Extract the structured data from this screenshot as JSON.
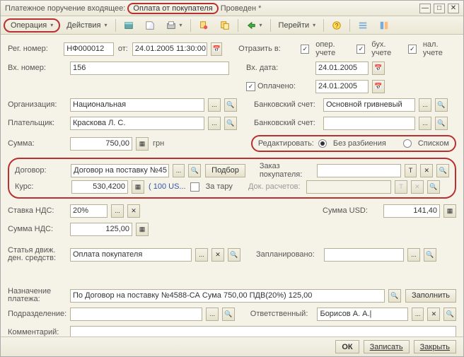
{
  "title": {
    "pre": "Платежное поручение входящее:",
    "hl": "Оплата от покупателя",
    "post": "Проведен *"
  },
  "toolbar": {
    "operation": "Операция",
    "actions": "Действия",
    "goto": "Перейти"
  },
  "labels": {
    "reg_no": "Рег. номер:",
    "from": "от:",
    "in_no": "Вх. номер:",
    "org": "Организация:",
    "payer": "Плательщик:",
    "sum": "Сумма:",
    "currency": "грн",
    "contract": "Договор:",
    "select": "Подбор",
    "rate": "Курс:",
    "rate_hint": "( 100 US...",
    "tare": "За тару",
    "vat_rate": "Ставка НДС:",
    "vat_sum": "Сумма НДС:",
    "cash_flow": "Статья движ. ден. средств:",
    "purpose": "Назначение платежа:",
    "fill": "Заполнить",
    "dept": "Подразделение:",
    "comment": "Комментарий:",
    "reflect": "Отразить в:",
    "oper": "опер. учете",
    "buh": "бух. учете",
    "nal": "нал. учете",
    "in_date": "Вх. дата:",
    "paid": "Оплачено:",
    "bank_acc": "Банковский счет:",
    "bank_acc2": "Банковский счет:",
    "edit": "Редактировать:",
    "no_split": "Без разбиения",
    "list": "Списком",
    "order": "Заказ покупателя:",
    "doc_calc": "Док. расчетов:",
    "sum_usd": "Сумма USD:",
    "planned": "Запланировано:",
    "responsible": "Ответственный:"
  },
  "values": {
    "reg_no": "НФ000012",
    "date": "24.01.2005 11:30:00",
    "in_no": "156",
    "org": "Национальная",
    "payer": "Краскова Л. С.",
    "sum": "750,00",
    "contract": "Договор на поставку №45",
    "rate": "530,4200",
    "vat_rate": "20%",
    "vat_sum": "125,00",
    "cash_flow": "Оплата покупателя",
    "purpose": "По Договор на поставку №4588-СА Сума 750,00 ПДВ(20%) 125,00",
    "in_date": "24.01.2005",
    "paid_date": "24.01.2005",
    "bank_acc": "Основной гривневый",
    "sum_usd": "141,40",
    "responsible": "Борисов А. А.|"
  },
  "buttons": {
    "ok": "ОК",
    "save": "Записать",
    "close": "Закрыть"
  }
}
